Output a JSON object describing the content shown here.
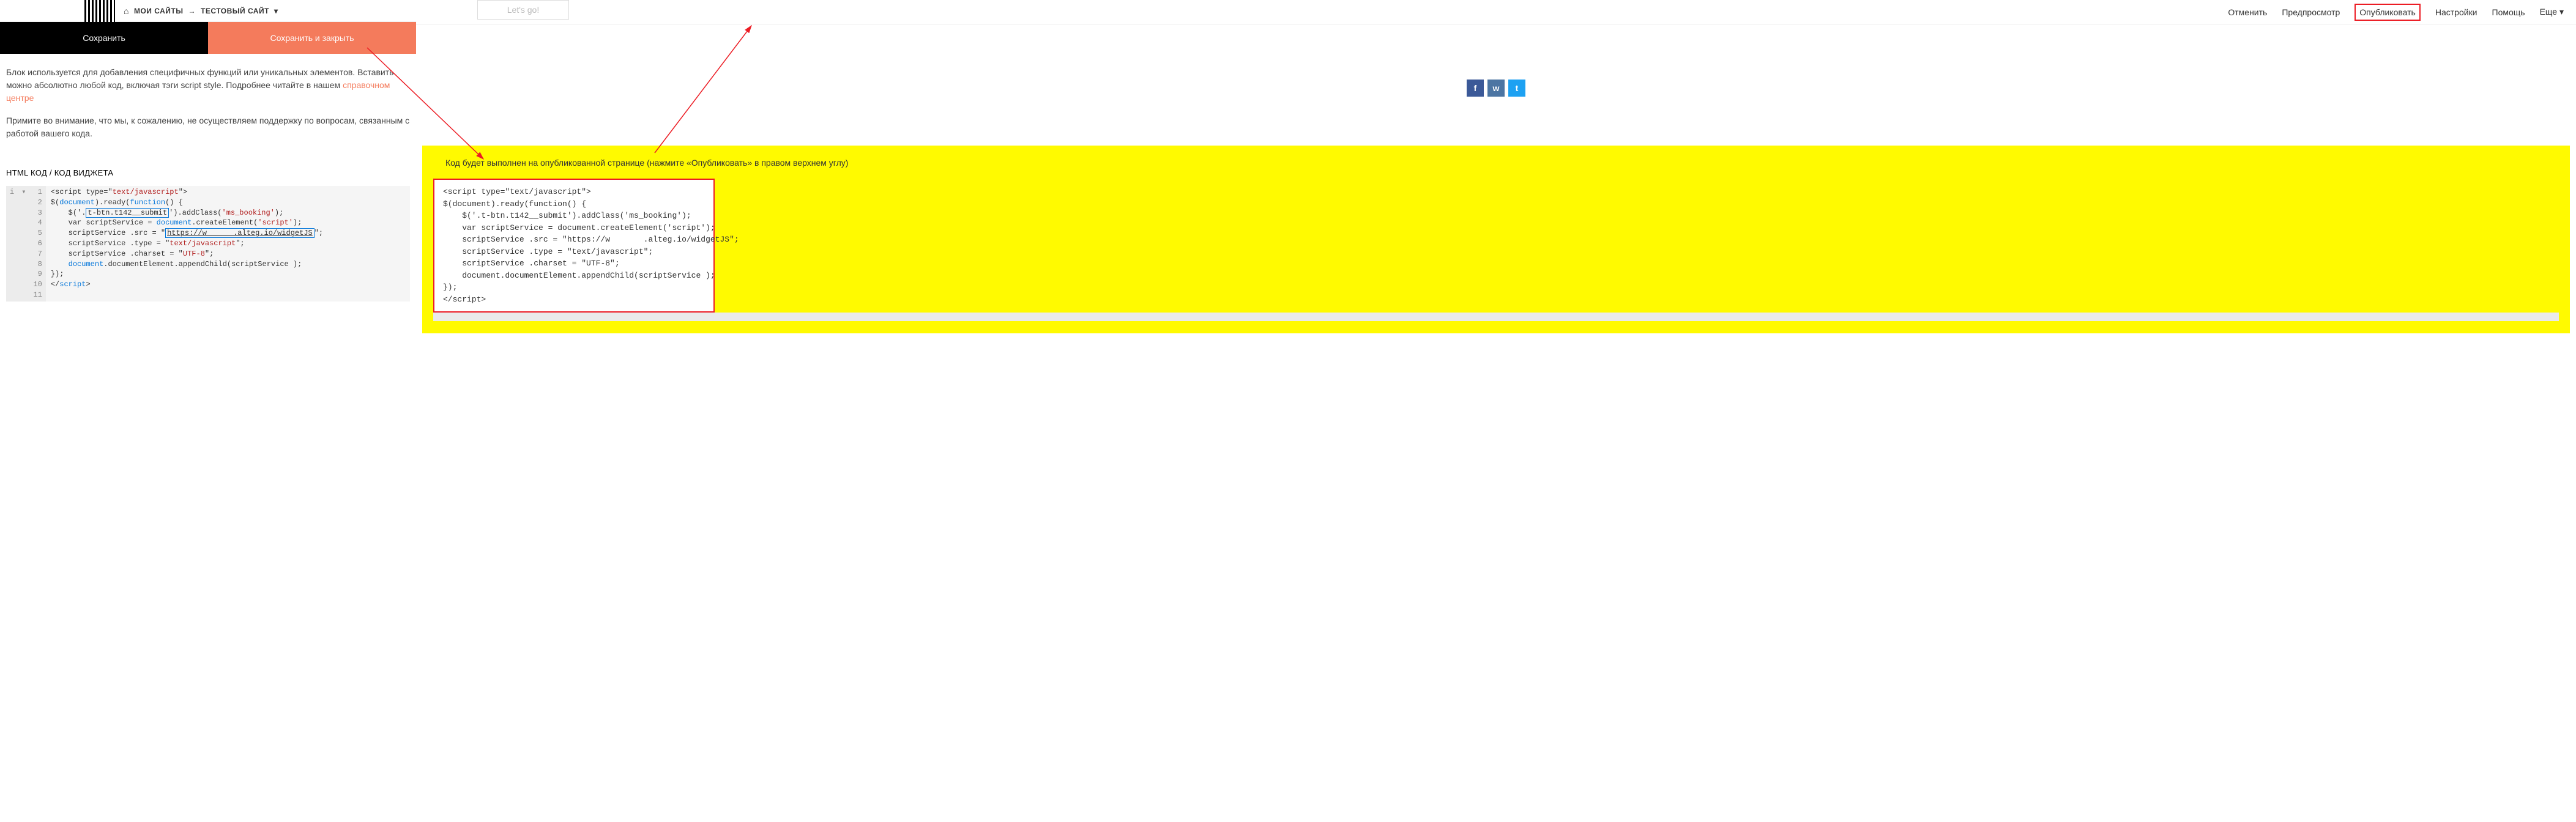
{
  "breadcrumb": {
    "my_sites": "МОИ САЙТЫ",
    "arrow": "→",
    "site_name": "ТЕСТОВЫЙ САЙТ",
    "caret": "▾"
  },
  "buttons": {
    "save": "Сохранить",
    "save_close": "Сохранить и закрыть"
  },
  "info": {
    "p1a": "Блок используется для добавления специфичных функций или уникальных элементов. Вставить можно абсолютно любой код, включая тэги script style. Подробнее читайте в нашем ",
    "p1_link": "справочном центре",
    "p2": "Примите во внимание, что мы, к сожалению, не осуществляем поддержку по вопросам, связанным с работой вашего кода."
  },
  "section_title": "HTML КОД / КОД ВИДЖЕТА",
  "editor": {
    "lines": [
      "1",
      "2",
      "3",
      "4",
      "5",
      "6",
      "7",
      "8",
      "9",
      "10",
      "11"
    ],
    "l1a": "<script type=\"",
    "l1b": "text/javascript",
    "l1c": "\">",
    "l2a": "$(",
    "l2b": "document",
    "l2c": ").ready(",
    "l2d": "function",
    "l2e": "() {",
    "l3a": "    $('.",
    "l3b": "t-btn.t142__submit",
    "l3c": "').addClass(",
    "l3d": "'ms_booking'",
    "l3e": ");",
    "l4a": "    var scriptService = ",
    "l4b": "document",
    "l4c": ".createElement(",
    "l4d": "'script'",
    "l4e": ");",
    "l5a": "    scriptService .src = \"",
    "l5b": "https://w      .alteg.io/widgetJS",
    "l5c": "\";",
    "l6a": "    scriptService .type = \"",
    "l6b": "text/javascript",
    "l6c": "\";",
    "l7a": "    scriptService .charset = \"",
    "l7b": "UTF-8",
    "l7c": "\";",
    "l8a": "    ",
    "l8b": "document",
    "l8c": ".documentElement.appendChild(scriptService );",
    "l9": "});",
    "l10a": "</",
    "l10b": "script",
    "l10c": ">"
  },
  "top_menu": {
    "cancel": "Отменить",
    "preview": "Предпросмотр",
    "publish": "Опубликовать",
    "settings": "Настройки",
    "help": "Помощь",
    "more": "Еще",
    "more_caret": "▾"
  },
  "lets_go": "Let's go!",
  "socials": {
    "fb": "f",
    "vk": "w",
    "tw": "t"
  },
  "yellow": {
    "caption": "Код будет выполнен на опубликованной странице (нажмите «Опубликовать» в правом верхнем углу)",
    "code": "<script type=\"text/javascript\">\n$(document).ready(function() {\n    $('.t-btn.t142__submit').addClass('ms_booking');\n    var scriptService = document.createElement('script');\n    scriptService .src = \"https://w       .alteg.io/widgetJS\";\n    scriptService .type = \"text/javascript\";\n    scriptService .charset = \"UTF-8\";\n    document.documentElement.appendChild(scriptService );\n});\n</script>"
  }
}
